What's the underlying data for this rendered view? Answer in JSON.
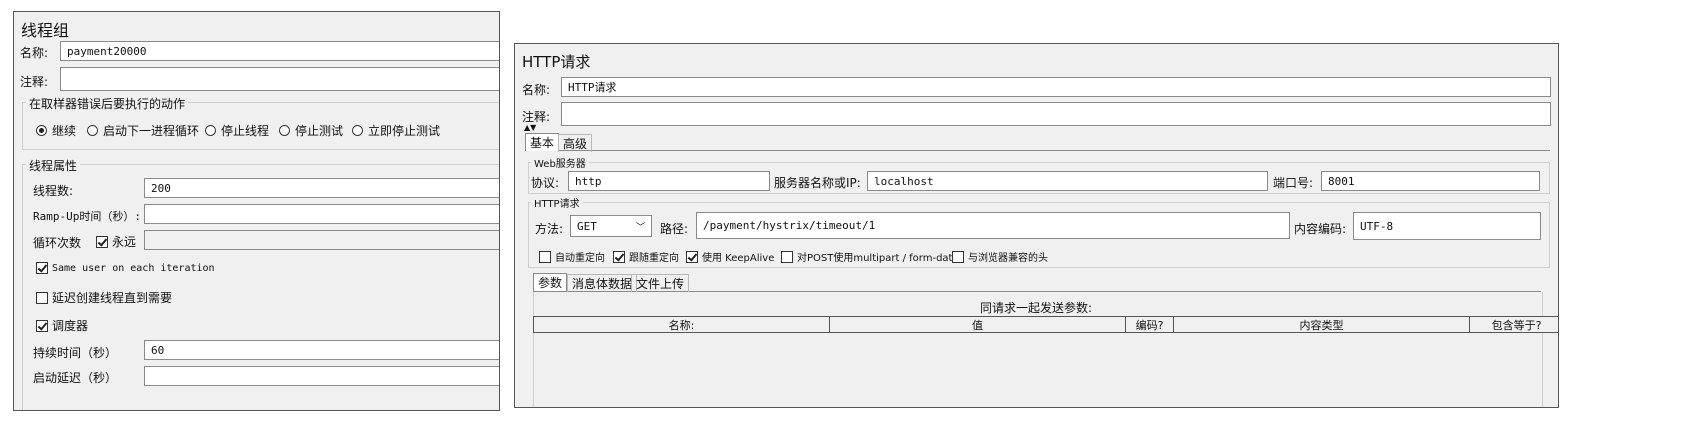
{
  "thread_group": {
    "title": "线程组",
    "name_label": "名称:",
    "name_value": "payment20000",
    "comment_label": "注释:",
    "comment_value": "",
    "error_action": {
      "legend": "在取样器错误后要执行的动作",
      "options": [
        "继续",
        "启动下一进程循环",
        "停止线程",
        "停止测试",
        "立即停止测试"
      ],
      "selected": "继续"
    },
    "props": {
      "legend": "线程属性",
      "threads_label": "线程数:",
      "threads_value": "200",
      "rampup_label": "Ramp-Up时间（秒）:",
      "rampup_value": "",
      "loop_label": "循环次数",
      "forever_label": "永远",
      "forever_checked": true,
      "loop_value": "",
      "same_user_label": "Same user on each iteration",
      "same_user_checked": true,
      "delay_create_label": "延迟创建线程直到需要",
      "delay_create_checked": false,
      "scheduler_label": "调度器",
      "scheduler_checked": true,
      "duration_label": "持续时间（秒）",
      "duration_value": "60",
      "startup_delay_label": "启动延迟（秒）",
      "startup_delay_value": ""
    }
  },
  "http_request": {
    "title": "HTTP请求",
    "name_label": "名称:",
    "name_value": "HTTP请求",
    "comment_label": "注释:",
    "comment_value": "",
    "tabs": [
      "基本",
      "高级"
    ],
    "active_tab": "基本",
    "web_server": {
      "legend": "Web服务器",
      "protocol_label": "协议:",
      "protocol_value": "http",
      "server_label": "服务器名称或IP:",
      "server_value": "localhost",
      "port_label": "端口号:",
      "port_value": "8001"
    },
    "http": {
      "legend": "HTTP请求",
      "method_label": "方法:",
      "method_value": "GET",
      "path_label": "路径:",
      "path_value": "/payment/hystrix/timeout/1",
      "encoding_label": "内容编码:",
      "encoding_value": "UTF-8"
    },
    "options": [
      {
        "label": "自动重定向",
        "checked": false
      },
      {
        "label": "跟随重定向",
        "checked": true
      },
      {
        "label": "使用 KeepAlive",
        "checked": true
      },
      {
        "label": "对POST使用multipart / form-data",
        "checked": false
      },
      {
        "label": "与浏览器兼容的头",
        "checked": false
      }
    ],
    "param_tabs": [
      "参数",
      "消息体数据",
      "文件上传"
    ],
    "active_param_tab": "参数",
    "params_title": "同请求一起发送参数:",
    "columns": [
      "名称:",
      "值",
      "编码?",
      "内容类型",
      "包含等于?"
    ]
  }
}
